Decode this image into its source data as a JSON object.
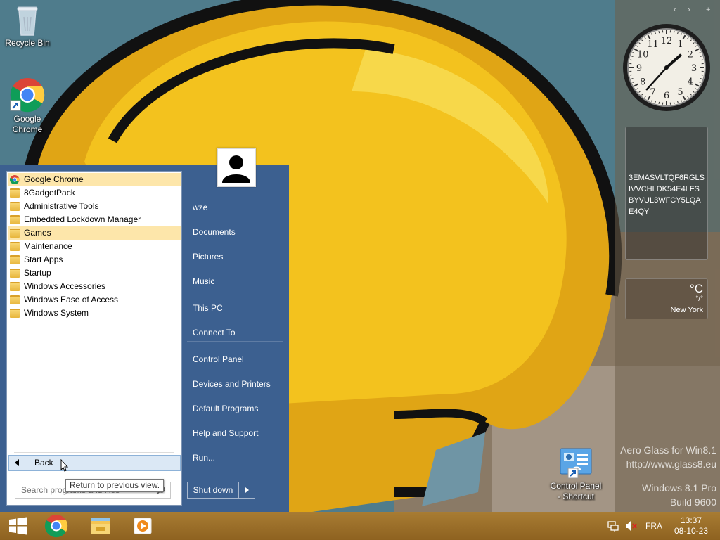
{
  "desktop": {
    "icons": [
      {
        "label": "Recycle Bin",
        "icon": "recycle-bin-icon"
      },
      {
        "label": "Google Chrome",
        "icon": "chrome-icon"
      },
      {
        "label": "Control Panel - Shortcut",
        "icon": "control-panel-icon"
      }
    ]
  },
  "gadgets": {
    "nav": {
      "prev": "‹",
      "next": "›",
      "add": "+"
    },
    "clock": {
      "hour": 1,
      "minute": 37,
      "numbers": [
        "12",
        "1",
        "2",
        "3",
        "4",
        "5",
        "6",
        "7",
        "8",
        "9",
        "10",
        "11"
      ]
    },
    "note": {
      "text": "3EMASVLTQF6RGLSIVVCHLDK54E4LFSBYVUL3WFCY5LQAE4QY"
    },
    "weather": {
      "unit": "°C",
      "range": "°/°",
      "city": "New York"
    }
  },
  "watermark": {
    "line1": "Aero Glass for Win8.1",
    "line2": "http://www.glass8.eu",
    "line3": "Windows 8.1 Pro",
    "line4": "Build 9600"
  },
  "start_menu": {
    "programs": [
      {
        "label": "Google Chrome",
        "icon": "chrome-icon",
        "highlighted": true
      },
      {
        "label": "8GadgetPack",
        "icon": "folder-icon",
        "highlighted": false
      },
      {
        "label": "Administrative Tools",
        "icon": "folder-icon",
        "highlighted": false
      },
      {
        "label": "Embedded Lockdown Manager",
        "icon": "folder-icon",
        "highlighted": false
      },
      {
        "label": "Games",
        "icon": "folder-icon",
        "highlighted": true
      },
      {
        "label": "Maintenance",
        "icon": "folder-icon",
        "highlighted": false
      },
      {
        "label": "Start Apps",
        "icon": "folder-icon",
        "highlighted": false
      },
      {
        "label": "Startup",
        "icon": "folder-icon",
        "highlighted": false
      },
      {
        "label": "Windows Accessories",
        "icon": "folder-icon",
        "highlighted": false
      },
      {
        "label": "Windows Ease of Access",
        "icon": "folder-icon",
        "highlighted": false
      },
      {
        "label": "Windows System",
        "icon": "folder-icon",
        "highlighted": false
      }
    ],
    "back_label": "Back",
    "tooltip": "Return to previous view.",
    "search_placeholder": "Search programs and files",
    "right_links": [
      {
        "label": "wze"
      },
      {
        "label": "Documents"
      },
      {
        "label": "Pictures"
      },
      {
        "label": "Music"
      },
      {
        "label": "This PC"
      },
      {
        "label": "Connect To"
      },
      {
        "label": "Control Panel"
      },
      {
        "label": "Devices and Printers"
      },
      {
        "label": "Default Programs"
      },
      {
        "label": "Help and Support"
      },
      {
        "label": "Run..."
      }
    ],
    "shutdown_label": "Shut down"
  },
  "taskbar": {
    "pinned": [
      {
        "icon": "chrome-icon"
      },
      {
        "icon": "file-explorer-icon"
      },
      {
        "icon": "media-player-icon"
      }
    ],
    "language": "FRA",
    "time": "13:37",
    "date": "08-10-23"
  },
  "colors": {
    "start_menu_blue": "#3c6090",
    "highlight": "#fde6aa",
    "taskbar": "#9a6e28"
  }
}
